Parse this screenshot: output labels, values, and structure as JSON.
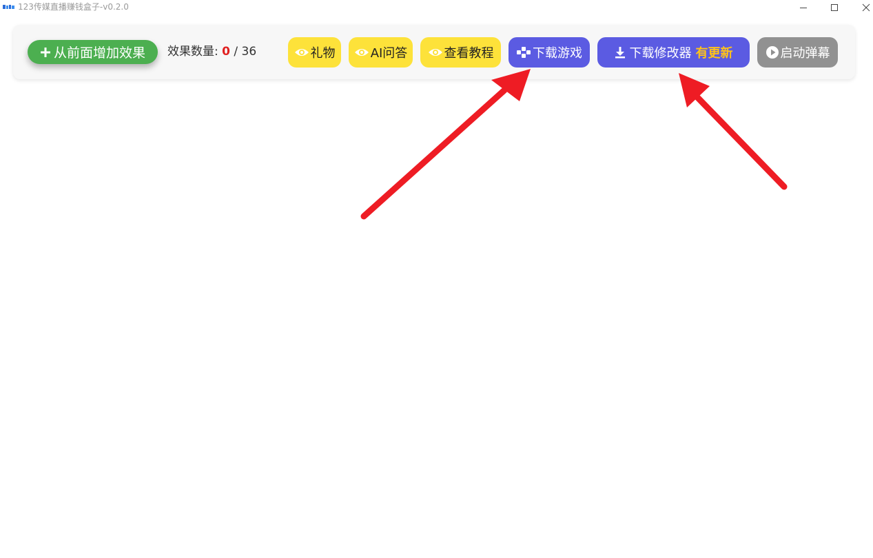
{
  "window": {
    "title": "123传媒直播赚钱盒子-v0.2.0",
    "controls": [
      "minimize",
      "maximize",
      "close"
    ]
  },
  "toolbar": {
    "add_button_label": "从前面增加效果",
    "count": {
      "label": "效果数量:",
      "current": "0",
      "separator": "/",
      "total": "36"
    },
    "buttons": [
      {
        "label": "礼物",
        "icon": "eye-icon"
      },
      {
        "label": "AI问答",
        "icon": "eye-icon"
      },
      {
        "label": "查看教程",
        "icon": "eye-icon"
      },
      {
        "label": "下载游戏",
        "icon": "gamepad-icon"
      },
      {
        "label": "下载修改器",
        "badge": "有更新",
        "icon": "download-icon"
      },
      {
        "label": "启动弹幕",
        "icon": "play-circle-icon"
      }
    ]
  },
  "colors": {
    "add_button": "#4caf50",
    "yellow_button": "#fde23a",
    "blue_button": "#5b5be2",
    "gray_button": "#919191",
    "update_badge": "#ffc21a",
    "count_current": "#e02020",
    "annotation_arrow": "#ee1c24"
  }
}
